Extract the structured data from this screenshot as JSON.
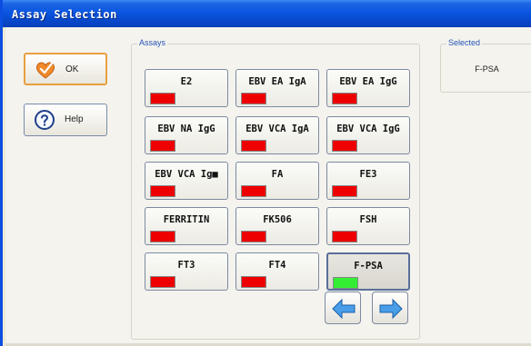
{
  "window": {
    "title": "Assay Selection"
  },
  "side_buttons": {
    "ok": {
      "label": "OK",
      "icon": "heart-check-icon"
    },
    "help": {
      "label": "Help",
      "icon": "help-icon"
    }
  },
  "assays_group": {
    "legend": "Assays"
  },
  "selected_group": {
    "legend": "Selected",
    "value": "F-PSA"
  },
  "assays": [
    {
      "name": "E2",
      "status": "red"
    },
    {
      "name": "EBV EA IgA",
      "status": "red"
    },
    {
      "name": "EBV EA IgG",
      "status": "red"
    },
    {
      "name": "EBV NA IgG",
      "status": "red"
    },
    {
      "name": "EBV VCA IgA",
      "status": "red"
    },
    {
      "name": "EBV VCA IgG",
      "status": "red"
    },
    {
      "name": "EBV VCA Ig■",
      "status": "red"
    },
    {
      "name": "FA",
      "status": "red"
    },
    {
      "name": "FE3",
      "status": "red"
    },
    {
      "name": "FERRITIN",
      "status": "red"
    },
    {
      "name": "FK506",
      "status": "red"
    },
    {
      "name": "FSH",
      "status": "red"
    },
    {
      "name": "FT3",
      "status": "red"
    },
    {
      "name": "FT4",
      "status": "red"
    },
    {
      "name": "F-PSA",
      "status": "green",
      "selected": true
    }
  ],
  "colors": {
    "status_red": "#ee0000",
    "status_green": "#33ee33",
    "titlebar": "#0a56e0"
  },
  "navigation": {
    "prev_icon": "arrow-left-icon",
    "next_icon": "arrow-right-icon"
  }
}
